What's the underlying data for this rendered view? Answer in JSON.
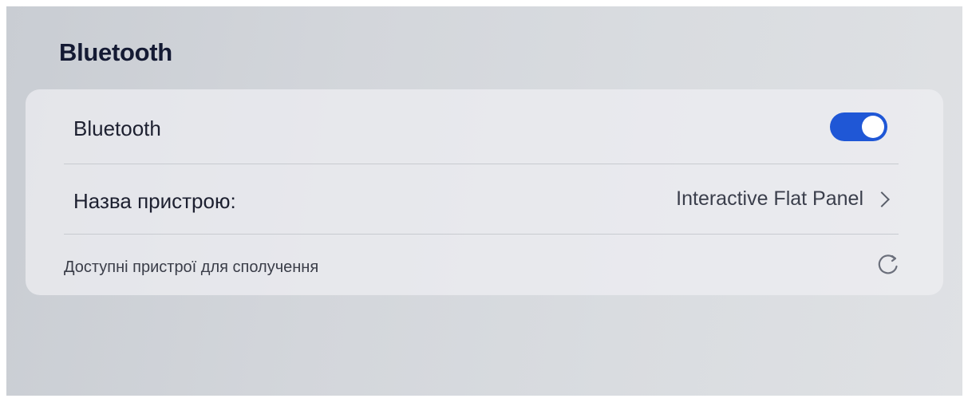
{
  "page": {
    "title": "Bluetooth"
  },
  "bluetooth_row": {
    "label": "Bluetooth",
    "toggle_on": true,
    "toggle_color": "#1f57d6"
  },
  "device_name_row": {
    "label": "Назва пристрою:",
    "value": "Interactive Flat Panel",
    "icon": "chevron-right-icon"
  },
  "available_row": {
    "label": "Доступні пристрої для сполучення",
    "icon": "refresh-icon"
  }
}
